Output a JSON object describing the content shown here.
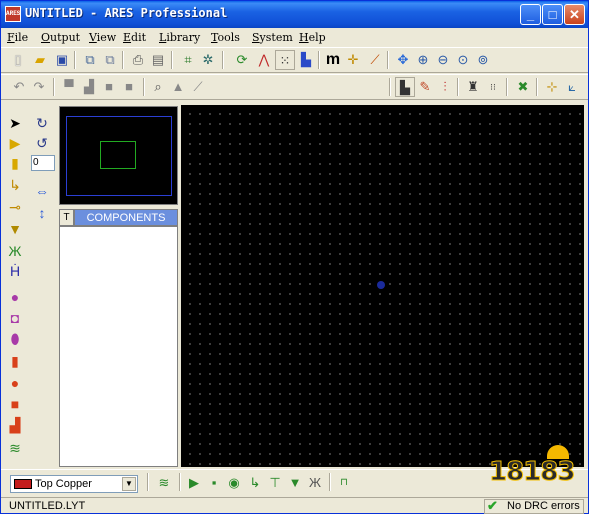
{
  "window": {
    "app_icon_text": "ARES",
    "title": "UNTITLED - ARES Professional",
    "minimize": "_",
    "maximize": "□",
    "close": "✕"
  },
  "menu": [
    "File",
    "Output",
    "View",
    "Edit",
    "Library",
    "Tools",
    "System",
    "Help"
  ],
  "toolbar1_icons": [
    "new-icon",
    "open-icon",
    "save-icon",
    "import-icon",
    "export-icon",
    "print-icon",
    "print-preview-icon",
    "grid-icon",
    "snap-icon",
    "refresh-icon",
    "flip-icon",
    "dot-grid-icon",
    "pick-icon",
    "metric-icon",
    "origin-icon",
    "false-origin-icon",
    "pan-icon",
    "zoom-in-icon",
    "zoom-out-icon",
    "zoom-all-icon",
    "zoom-area-icon"
  ],
  "toolbar2_icons": [
    "undo-icon",
    "redo-icon",
    "block-copy-icon",
    "block-move-icon",
    "block-rotate-icon",
    "block-delete-icon",
    "search-icon",
    "tag-icon",
    "tools-icon",
    "layer-icon",
    "netlist-icon",
    "route-icon",
    "find-icon",
    "design-rule-icon",
    "auto-route-icon",
    "drc-icon",
    "3d-view-icon"
  ],
  "left_tools_icons": [
    "select-icon",
    "component-icon",
    "package-icon",
    "track-icon",
    "via-icon",
    "zone-icon",
    "ratsnest-icon",
    "connectivity-icon",
    "round-pad-icon",
    "square-pad-icon",
    "dil-pad-icon",
    "edge-pad-icon",
    "circle-pad-icon",
    "polygon-pad-icon",
    "padstack-icon",
    "layers-icon"
  ],
  "rotation_value": "0",
  "components_panel": {
    "tab": "T",
    "title": "COMPONENTS"
  },
  "layer_select": {
    "value": "Top Copper",
    "color": "#c41c1c"
  },
  "status": {
    "file": "UNTITLED.LYT",
    "drc": "No DRC errors"
  },
  "watermark": "18183",
  "colors": {
    "titlebar": "#0f4fd6",
    "canvas": "#000000",
    "grid_dot": "#8a8a8a",
    "panel_header": "#6b8fde",
    "overview_board": "#2b3fd4",
    "overview_view": "#22aa22"
  }
}
